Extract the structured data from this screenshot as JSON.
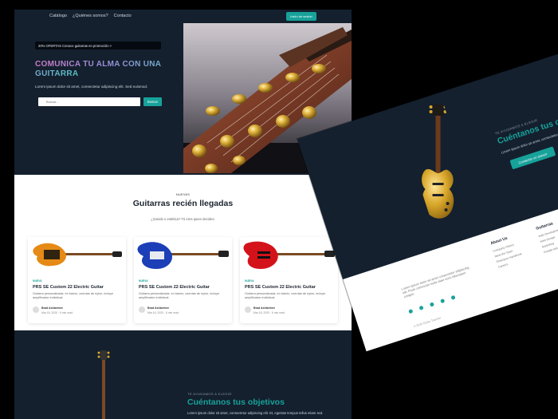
{
  "nav": {
    "links": [
      "Catálogo",
      "¿Quiénes somos?",
      "Contacto"
    ],
    "cta": "Inicio de sesión"
  },
  "hero": {
    "promo": "20% OFERTAS Conoce guitarras en promoción >",
    "title": "COMUNICA TU ALMA CON UNA GUITARRA",
    "subtitle": "Lorem ipsum dolor sit amet, consectetur adipiscing elit. Sed euismod.",
    "search_placeholder": "Buscar...",
    "search_button": "Buscar"
  },
  "arrivals": {
    "eyebrow": "NUEVAS",
    "title": "Guitarras recién llegadas",
    "lead": "¿Sonido o estética? Tú eres quien decides.",
    "cards": [
      {
        "tag": "NUEVA",
        "title": "PRS SE Custom 22 Electric Guitar",
        "desc": "Guitarra personalizada, en barniz, cuerdas de nylon, incluye amplificador individual.",
        "author": "Brad Ashberber",
        "date": "Mar 16, 2020 · 6 min read",
        "color": "#e58a16"
      },
      {
        "tag": "NUEVA",
        "title": "PRS SE Custom 22 Electric Guitar",
        "desc": "Guitarra personalizada, en barniz, cuerdas de nylon, incluye amplificador individual.",
        "author": "Brad Ashberber",
        "date": "Mar 16, 2020 · 6 min read",
        "color": "#1c3fb8"
      },
      {
        "tag": "NUEVA",
        "title": "PRS SE Custom 22 Electric Guitar",
        "desc": "Guitarra personalizada, en barniz, cuerdas de nylon, incluye amplificador individual.",
        "author": "Brad Ashberber",
        "date": "Mar 16, 2020 · 6 min read",
        "color": "#d4121a"
      }
    ]
  },
  "objectives": {
    "eyebrow": "TE AYUDAMOS A ELEGIR",
    "title": "Cuéntanos tus objetivos",
    "lead": "Lorem ipsum dolor sit amet, consectetur adipiscing elit. Et, egestas tempus tellus etiam sed.",
    "button": "Contactar un asesor"
  },
  "footer": {
    "about_text": "Lorem ipsum dolor sit amet consectetur adipiscing elit. Proin commodo nulla vitae nunc bibendum congue.",
    "copyright": "© 2020 Guitar Teacher",
    "about_title": "About Us",
    "about_items": [
      "Company History",
      "Meet the Team",
      "Employee Handbook",
      "Careers"
    ],
    "guitars_title": "Guitarras",
    "guitars_items": [
      "Web Development",
      "Web Design",
      "Marketing",
      "Google Ads"
    ],
    "social_icons": [
      "facebook-icon",
      "instagram-icon",
      "twitter-icon",
      "github-icon",
      "dribbble-icon"
    ]
  },
  "colors": {
    "background": "#14202e",
    "accent": "#17a29a",
    "gold_guitar": "#d9a72a"
  }
}
